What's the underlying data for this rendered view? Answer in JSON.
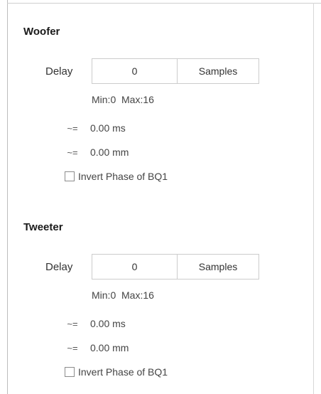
{
  "woofer": {
    "title": "Woofer",
    "delay_label": "Delay",
    "delay_value": "0",
    "delay_unit": "Samples",
    "range": "Min:0  Max:16",
    "approx_symbol_ms": "~=",
    "approx_ms": "0.00 ms",
    "approx_symbol_mm": "~=",
    "approx_mm": "0.00 mm",
    "invert_label": "Invert Phase of BQ1",
    "invert_checked": false
  },
  "tweeter": {
    "title": "Tweeter",
    "delay_label": "Delay",
    "delay_value": "0",
    "delay_unit": "Samples",
    "range": "Min:0  Max:16",
    "approx_symbol_ms": "~=",
    "approx_ms": "0.00 ms",
    "approx_symbol_mm": "~=",
    "approx_mm": "0.00 mm",
    "invert_label": "Invert Phase of BQ1",
    "invert_checked": false
  }
}
